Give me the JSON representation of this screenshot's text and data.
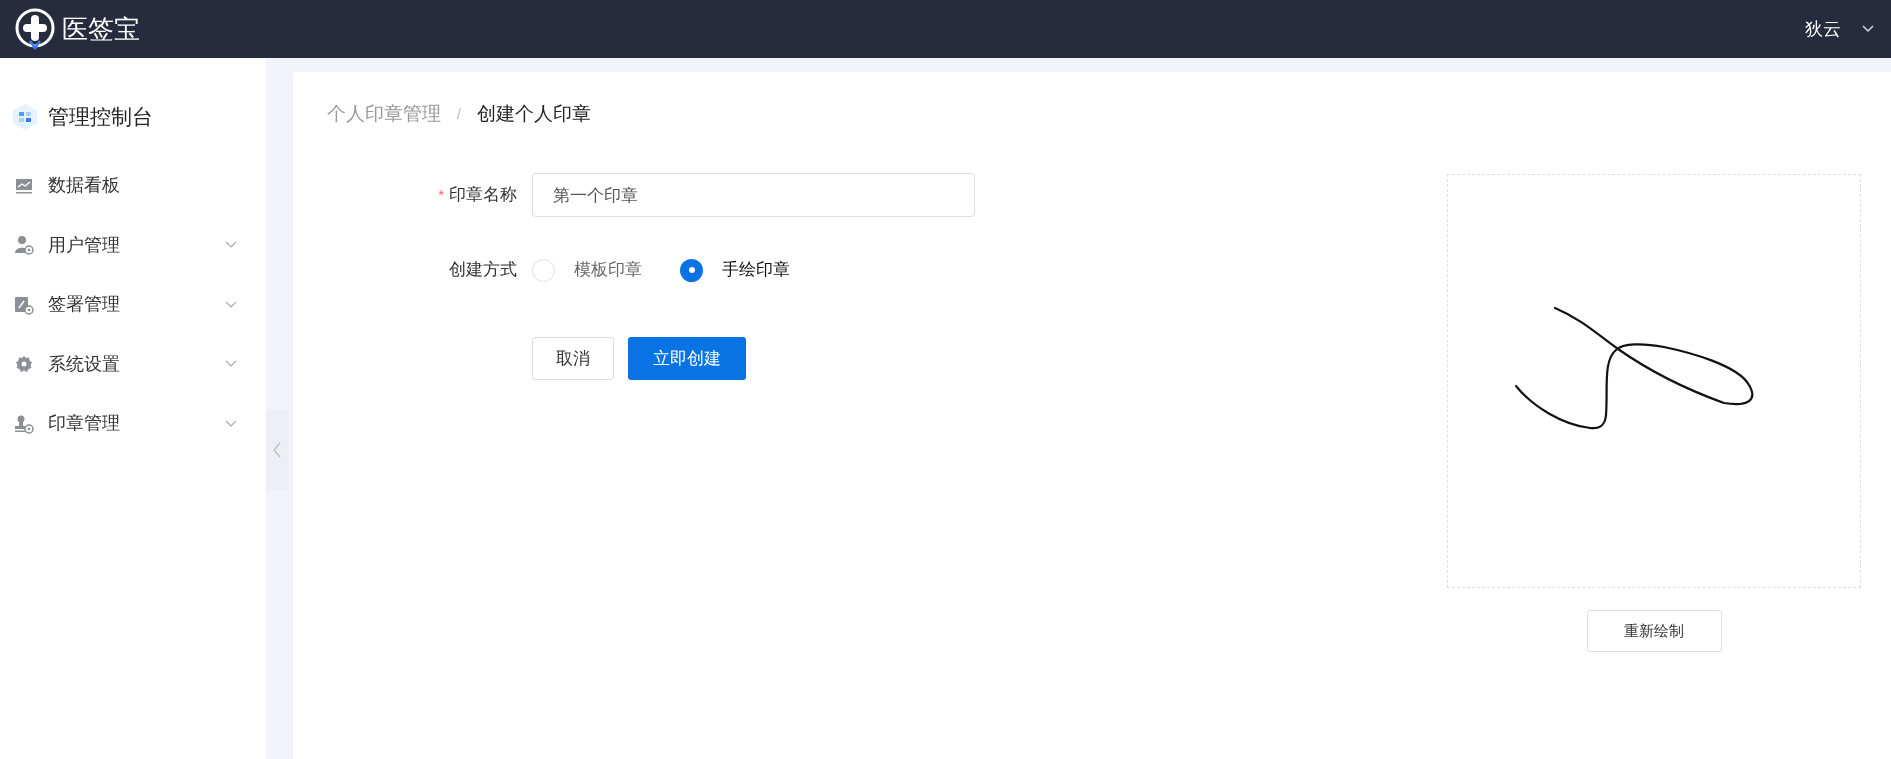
{
  "header": {
    "brand": "医签宝",
    "user": "狄云"
  },
  "sidebar": {
    "title": "管理控制台",
    "items": [
      {
        "label": "数据看板",
        "kind": "chart",
        "expandable": false
      },
      {
        "label": "用户管理",
        "kind": "user",
        "expandable": true
      },
      {
        "label": "签署管理",
        "kind": "sign",
        "expandable": true
      },
      {
        "label": "系统设置",
        "kind": "gear",
        "expandable": true
      },
      {
        "label": "印章管理",
        "kind": "stamp",
        "expandable": true
      }
    ]
  },
  "breadcrumb": [
    "个人印章管理",
    "/",
    "创建个人印章"
  ],
  "form": {
    "required_mark": "*",
    "name_label": "印章名称",
    "name_value": "第一个印章",
    "method_label": "创建方式",
    "methods": [
      {
        "label": "模板印章",
        "selected": false
      },
      {
        "label": "手绘印章",
        "selected": true
      }
    ],
    "buttons": [
      {
        "label": "取消",
        "kind": "default"
      },
      {
        "label": "立即创建",
        "kind": "primary"
      }
    ]
  },
  "canvas": {
    "redraw_button": "重新绘制"
  }
}
